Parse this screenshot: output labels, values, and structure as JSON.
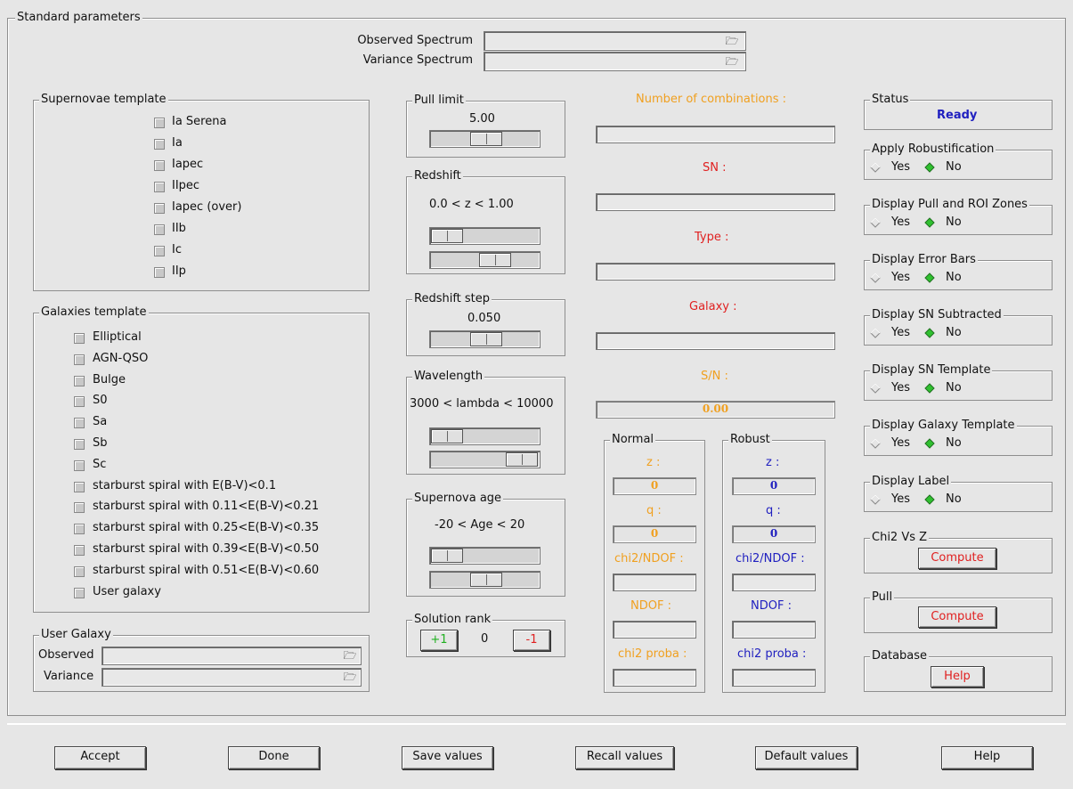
{
  "standard": {
    "title": "Standard parameters",
    "observed_label": "Observed Spectrum",
    "variance_label": "Variance Spectrum"
  },
  "sn_template": {
    "title": "Supernovae template",
    "items": [
      "Ia Serena",
      "Ia",
      "Iapec",
      "IIpec",
      "Iapec (over)",
      "IIb",
      "Ic",
      "IIp"
    ]
  },
  "gal_template": {
    "title": "Galaxies template",
    "items": [
      "Elliptical",
      "AGN-QSO",
      "Bulge",
      "S0",
      "Sa",
      "Sb",
      "Sc",
      "starburst spiral with E(B-V)<0.1",
      "starburst spiral with 0.11<E(B-V)<0.21",
      "starburst spiral with 0.25<E(B-V)<0.35",
      "starburst spiral with 0.39<E(B-V)<0.50",
      "starburst spiral with 0.51<E(B-V)<0.60",
      "User galaxy"
    ]
  },
  "user_galaxy": {
    "title": "User Galaxy",
    "observed_label": "Observed",
    "variance_label": "Variance"
  },
  "pull_limit": {
    "title": "Pull limit",
    "value": "5.00"
  },
  "redshift": {
    "title": "Redshift",
    "range": "0.0  < z <  1.00"
  },
  "redshift_step": {
    "title": "Redshift step",
    "value": "0.050"
  },
  "wavelength": {
    "title": "Wavelength",
    "range": "3000  < lambda <  10000"
  },
  "sn_age": {
    "title": "Supernova age",
    "range": "-20  < Age <  20"
  },
  "solution_rank": {
    "title": "Solution rank",
    "plus": "+1",
    "value": "0",
    "minus": "-1"
  },
  "results": {
    "combinations_label": "Number of combinations :",
    "sn_label": "SN :",
    "type_label": "Type :",
    "galaxy_label": "Galaxy :",
    "sn_ratio_label": "S/N :",
    "sn_ratio_value": "0.00"
  },
  "normal": {
    "title": "Normal",
    "z_label": "z :",
    "z_value": "0",
    "q_label": "q :",
    "q_value": "0",
    "chi2ndof_label": "chi2/NDOF :",
    "ndof_label": "NDOF :",
    "chi2proba_label": "chi2 proba :"
  },
  "robust": {
    "title": "Robust",
    "z_label": "z :",
    "z_value": "0",
    "q_label": "q :",
    "q_value": "0",
    "chi2ndof_label": "chi2/NDOF :",
    "ndof_label": "NDOF :",
    "chi2proba_label": "chi2 proba :"
  },
  "status": {
    "title": "Status",
    "value": "Ready"
  },
  "options": [
    {
      "title": "Apply Robustification",
      "yes": "Yes",
      "no": "No"
    },
    {
      "title": "Display Pull and ROI Zones",
      "yes": "Yes",
      "no": "No"
    },
    {
      "title": "Display Error Bars",
      "yes": "Yes",
      "no": "No"
    },
    {
      "title": "Display SN Subtracted",
      "yes": "Yes",
      "no": "No"
    },
    {
      "title": "Display SN Template",
      "yes": "Yes",
      "no": "No"
    },
    {
      "title": "Display Galaxy Template",
      "yes": "Yes",
      "no": "No"
    },
    {
      "title": "Display Label",
      "yes": "Yes",
      "no": "No"
    }
  ],
  "chi2vsz": {
    "title": "Chi2 Vs Z",
    "button": "Compute"
  },
  "pull": {
    "title": "Pull",
    "button": "Compute"
  },
  "database": {
    "title": "Database",
    "button": "Help"
  },
  "bottom": {
    "accept": "Accept",
    "done": "Done",
    "save": "Save values",
    "recall": "Recall values",
    "default": "Default values",
    "help": "Help"
  },
  "colors": {
    "orange": "#f0a020",
    "red": "#e02020",
    "blue": "#2020c0",
    "green": "#30c030"
  }
}
